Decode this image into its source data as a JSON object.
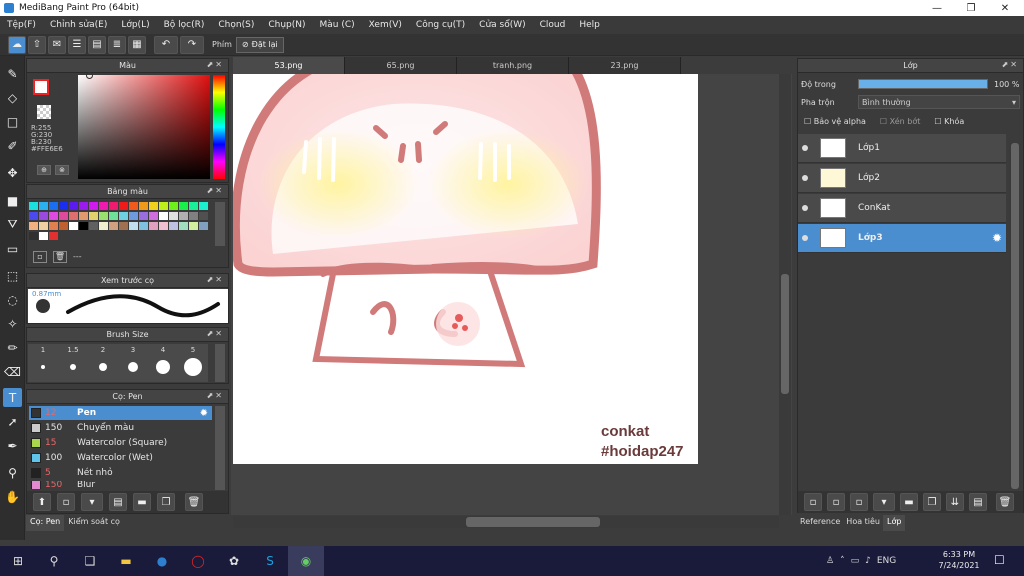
{
  "window": {
    "title": "MediBang Paint Pro (64bit)",
    "minimize": "—",
    "restore": "❐",
    "close": "✕"
  },
  "menu": [
    "Tệp(F)",
    "Chỉnh sửa(E)",
    "Lớp(L)",
    "Bộ lọc(R)",
    "Chọn(S)",
    "Chụp(N)",
    "Màu (C)",
    "Xem(V)",
    "Công cụ(T)",
    "Cửa sổ(W)",
    "Cloud",
    "Help"
  ],
  "toolbar": {
    "shortcut_label": "Phím",
    "reset_label": "Đặt lại"
  },
  "color_panel": {
    "title": "Màu",
    "r": "R:255",
    "g": "G:230",
    "b": "B:230",
    "hex": "#FFE6E6"
  },
  "palette_panel": {
    "title": "Bảng màu",
    "dashes": "---"
  },
  "brush_preview": {
    "title": "Xem trước cọ",
    "size": "0.87mm"
  },
  "brush_size": {
    "title": "Brush Size",
    "sizes": [
      "1",
      "1.5",
      "2",
      "3",
      "4",
      "5"
    ]
  },
  "brush_panel": {
    "title": "Cọ: Pen",
    "items": [
      {
        "size": "12",
        "name": "Pen",
        "color": "#333333"
      },
      {
        "size": "150",
        "name": "Chuyển màu",
        "color": "#cccccc"
      },
      {
        "size": "15",
        "name": "Watercolor (Square)",
        "color": "#a9d64a"
      },
      {
        "size": "100",
        "name": "Watercolor (Wet)",
        "color": "#5fc4e8"
      },
      {
        "size": "5",
        "name": "Nét nhỏ",
        "color": "#222222"
      },
      {
        "size": "150",
        "name": "Blur",
        "color": "#e38ad0"
      }
    ]
  },
  "bottom_tabs_left": [
    "Cọ: Pen",
    "Kiểm soát cọ"
  ],
  "tabs": [
    "53.png",
    "65.png",
    "tranh.png",
    "23.png"
  ],
  "canvas": {
    "watermark1": "conkat",
    "watermark2": "#hoidap247"
  },
  "layer_panel": {
    "title": "Lớp",
    "opacity_label": "Độ trong",
    "opacity_value": "100 %",
    "opacity_fraction": 1.0,
    "blend_label": "Pha trộn",
    "blend_value": "Bình thường",
    "protect_alpha": "Bảo vệ alpha",
    "clipping": "Xén bớt",
    "lock": "Khóa",
    "layers": [
      {
        "name": "Lớp1",
        "selected": false
      },
      {
        "name": "Lớp2",
        "selected": false
      },
      {
        "name": "ConKat",
        "selected": false
      },
      {
        "name": "Lớp3",
        "selected": true
      }
    ]
  },
  "bottom_tabs_right": [
    "Reference",
    "Hoa tiêu",
    "Lớp"
  ],
  "taskbar": {
    "lang": "ENG",
    "time": "6:33 PM",
    "date": "7/24/2021"
  },
  "colors": {
    "accent": "#4a8ecf",
    "pink_line": "#d07a7a"
  }
}
